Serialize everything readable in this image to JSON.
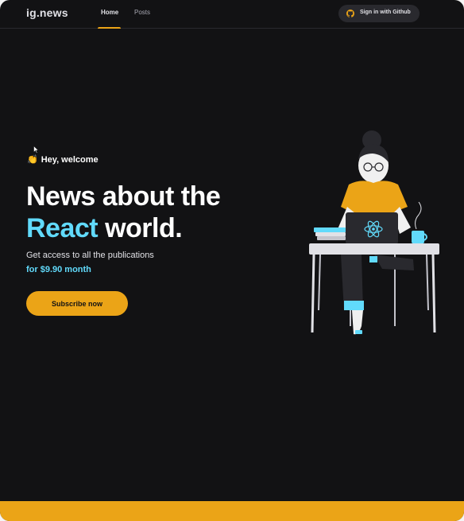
{
  "header": {
    "logo": "ig.news",
    "nav": [
      {
        "label": "Home",
        "active": true
      },
      {
        "label": "Posts",
        "active": false
      }
    ],
    "signin_label": "Sign in with Github",
    "signin_icon": "github-icon"
  },
  "hero": {
    "greeting_emoji": "clapping-hands-icon",
    "greeting": "Hey, welcome",
    "headline_line1": "News about the",
    "headline_accent": "React",
    "headline_rest": "world.",
    "subtext": "Get access to all the publications",
    "price": "for $9.90 month",
    "subscribe_label": "Subscribe now"
  },
  "colors": {
    "background": "#121214",
    "accent_yellow": "#eba417",
    "accent_cyan": "#61dafb",
    "text": "#e1e1e6"
  }
}
